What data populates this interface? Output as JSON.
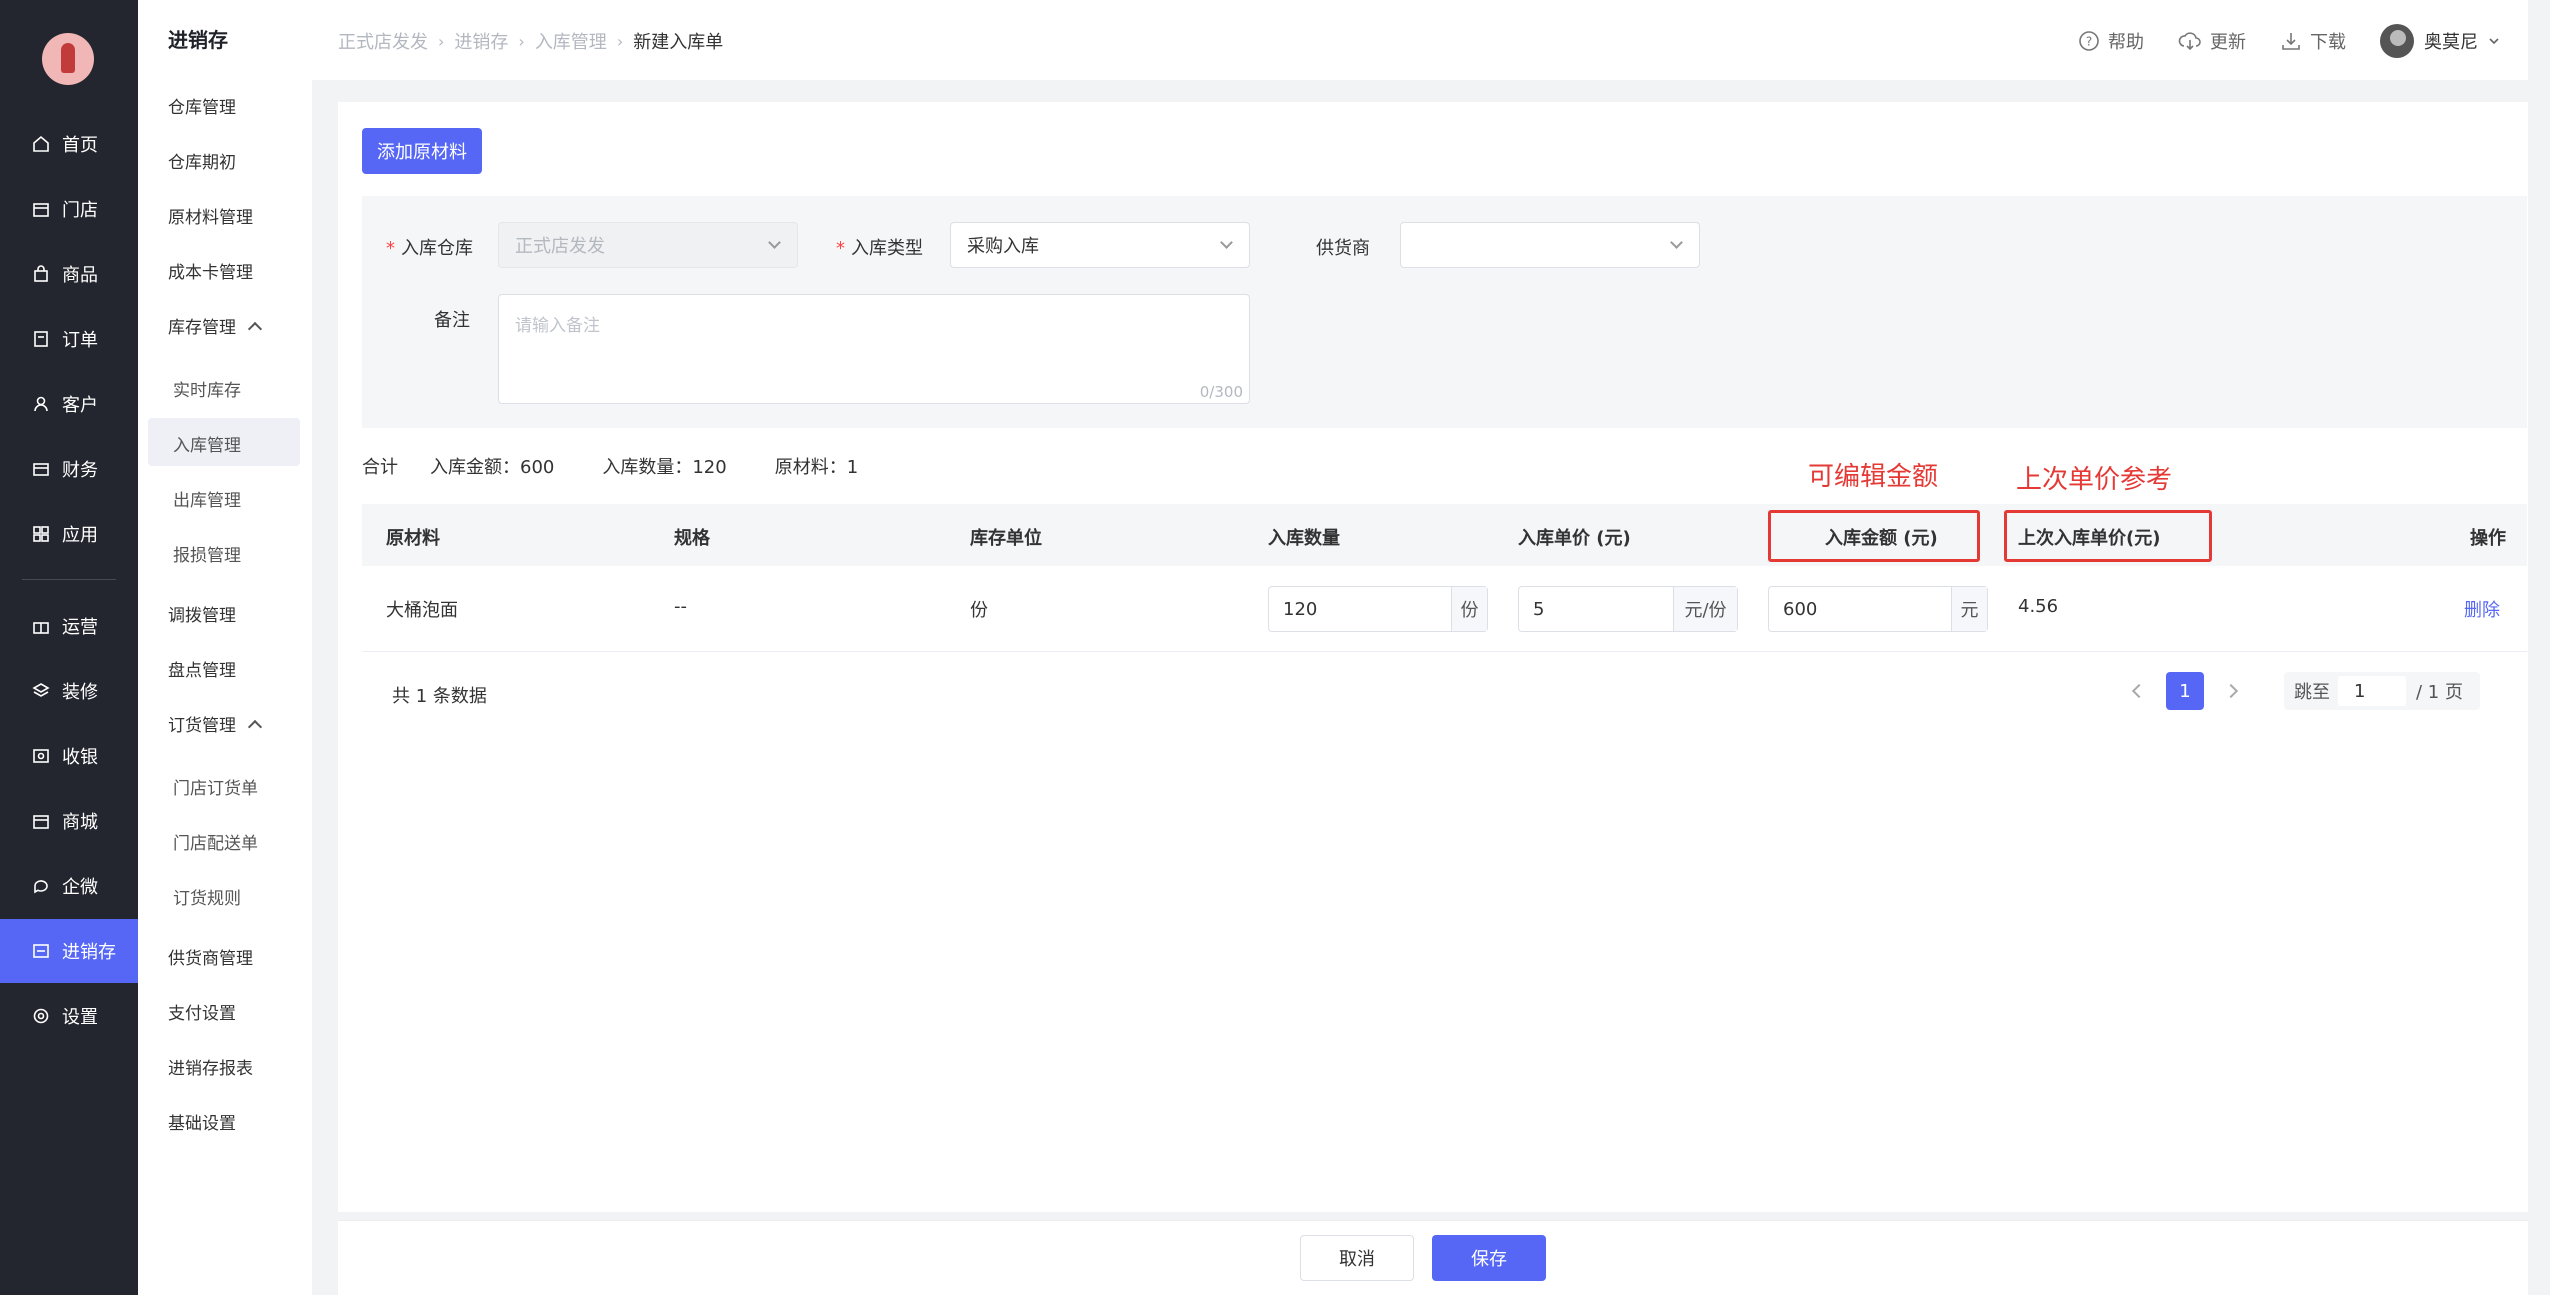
{
  "nav": {
    "items": [
      {
        "label": "首页",
        "icon": "home-icon"
      },
      {
        "label": "门店",
        "icon": "store-icon"
      },
      {
        "label": "商品",
        "icon": "bag-icon"
      },
      {
        "label": "订单",
        "icon": "order-icon"
      },
      {
        "label": "客户",
        "icon": "user-icon"
      },
      {
        "label": "财务",
        "icon": "card-icon"
      },
      {
        "label": "应用",
        "icon": "apps-icon"
      },
      {
        "label": "运营",
        "icon": "gift-icon"
      },
      {
        "label": "装修",
        "icon": "layers-icon"
      },
      {
        "label": "收银",
        "icon": "cash-icon"
      },
      {
        "label": "商城",
        "icon": "shop-icon"
      },
      {
        "label": "企微",
        "icon": "chat-icon"
      },
      {
        "label": "进销存",
        "icon": "inventory-icon"
      },
      {
        "label": "设置",
        "icon": "settings-icon"
      }
    ],
    "active": "进销存",
    "accent": "#5667f6"
  },
  "subnav": {
    "title": "进销存",
    "items": [
      "仓库管理",
      "仓库期初",
      "原材料管理",
      "成本卡管理",
      "库存管理",
      "实时库存",
      "入库管理",
      "出库管理",
      "报损管理",
      "调拨管理",
      "盘点管理",
      "订货管理",
      "门店订货单",
      "门店配送单",
      "订货规则",
      "供货商管理",
      "支付设置",
      "进销存报表",
      "基础设置"
    ]
  },
  "breadcrumb": [
    "正式店发发",
    "进销存",
    "入库管理",
    "新建入库单"
  ],
  "toolbar": {
    "help": "帮助",
    "update": "更新",
    "download": "下载",
    "user": "奥莫尼"
  },
  "page": {
    "add_button": "添加原材料",
    "form": {
      "warehouse_label": "入库仓库",
      "warehouse_value": "正式店发发",
      "type_label": "入库类型",
      "type_value": "采购入库",
      "supplier_label": "供货商",
      "supplier_value": "",
      "remark_label": "备注",
      "remark_placeholder": "请输入备注",
      "remark_count": "0/300"
    },
    "summary": {
      "total": "合计",
      "amount": "入库金额：600",
      "qty": "入库数量：120",
      "materials": "原材料：1"
    },
    "table": {
      "headers": [
        "原材料",
        "规格",
        "库存单位",
        "入库数量",
        "入库单价 (元)",
        "入库金额 (元)",
        "上次入库单价(元)",
        "操作"
      ],
      "rows": [
        {
          "material": "大桶泡面",
          "spec": "--",
          "unit": "份",
          "qty": "120",
          "qty_suffix": "份",
          "price": "5",
          "price_suffix": "元/份",
          "amount": "600",
          "amount_suffix": "元",
          "last_price": "4.56",
          "action": "删除"
        }
      ]
    },
    "annotations": {
      "amount_note": "可编辑金额",
      "last_price_note": "上次单价参考"
    },
    "pagination": {
      "total_text": "共 1 条数据",
      "current": "1",
      "jump_label": "跳至",
      "jump_value": "1",
      "pages": "/ 1 页"
    },
    "footer": {
      "cancel": "取消",
      "save": "保存"
    }
  }
}
